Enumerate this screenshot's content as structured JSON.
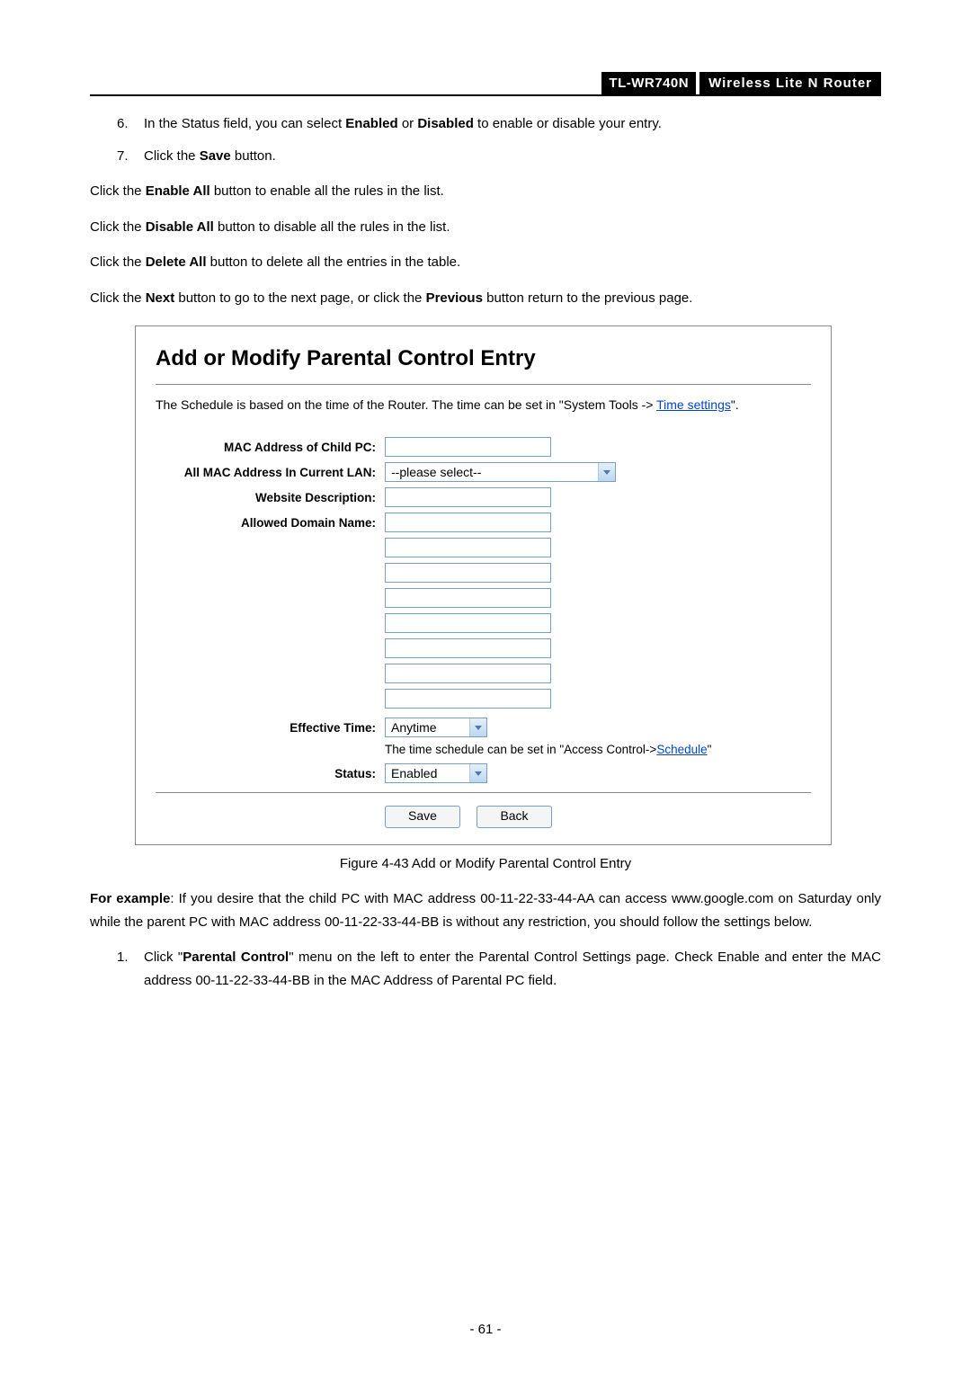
{
  "header": {
    "model": "TL-WR740N",
    "desc": "Wireless  Lite  N   Router"
  },
  "steps_top": [
    {
      "num": "6.",
      "pre": "In the Status field, you can select ",
      "b1": "Enabled",
      "mid": " or ",
      "b2": "Disabled",
      "post": " to enable or disable your entry."
    },
    {
      "num": "7.",
      "pre": "Click the ",
      "b1": "Save",
      "mid": "",
      "b2": "",
      "post": " button."
    }
  ],
  "paras": [
    {
      "pre": "Click the ",
      "b": "Enable All",
      "post": " button to enable all the rules in the list."
    },
    {
      "pre": "Click the ",
      "b": "Disable All",
      "post": " button to disable all the rules in the list."
    },
    {
      "pre": "Click the ",
      "b": "Delete All",
      "post": " button to delete all the entries in the table."
    }
  ],
  "nav_para": {
    "pre": "Click the ",
    "b1": "Next",
    "mid": " button to go to the next page, or click the ",
    "b2": "Previous",
    "post": " button return to the previous page."
  },
  "figure": {
    "title": "Add or Modify Parental Control Entry",
    "note_pre": "The Schedule is based on the time of the Router. The time can be set in \"System Tools -> ",
    "note_link": "Time settings",
    "note_post": "\".",
    "labels": {
      "mac_child": "MAC Address of Child PC:",
      "all_mac": "All MAC Address In Current LAN:",
      "website_desc": "Website Description:",
      "allowed_domain": "Allowed Domain Name:",
      "effective_time": "Effective Time:",
      "status": "Status:"
    },
    "select_placeholder": "--please select--",
    "effective_time_value": "Anytime",
    "schedule_hint_pre": "The time schedule can be set in \"Access Control->",
    "schedule_hint_link": "Schedule",
    "schedule_hint_post": "\"",
    "status_value": "Enabled",
    "save_btn": "Save",
    "back_btn": "Back"
  },
  "caption": "Figure 4-43    Add or Modify Parental Control Entry",
  "example": {
    "bold": "For example",
    "text": ": If you desire that the child PC with MAC address 00-11-22-33-44-AA can access www.google.com on Saturday only while the parent PC with MAC address 00-11-22-33-44-BB is without any restriction, you should follow the settings below."
  },
  "steps_bottom": [
    {
      "num": "1.",
      "pre": "Click \"",
      "b": "Parental Control",
      "post": "\" menu on the left to enter the Parental Control Settings page. Check Enable and enter the MAC address 00-11-22-33-44-BB in the MAC Address of Parental PC field."
    }
  ],
  "page_number": "- 61 -"
}
